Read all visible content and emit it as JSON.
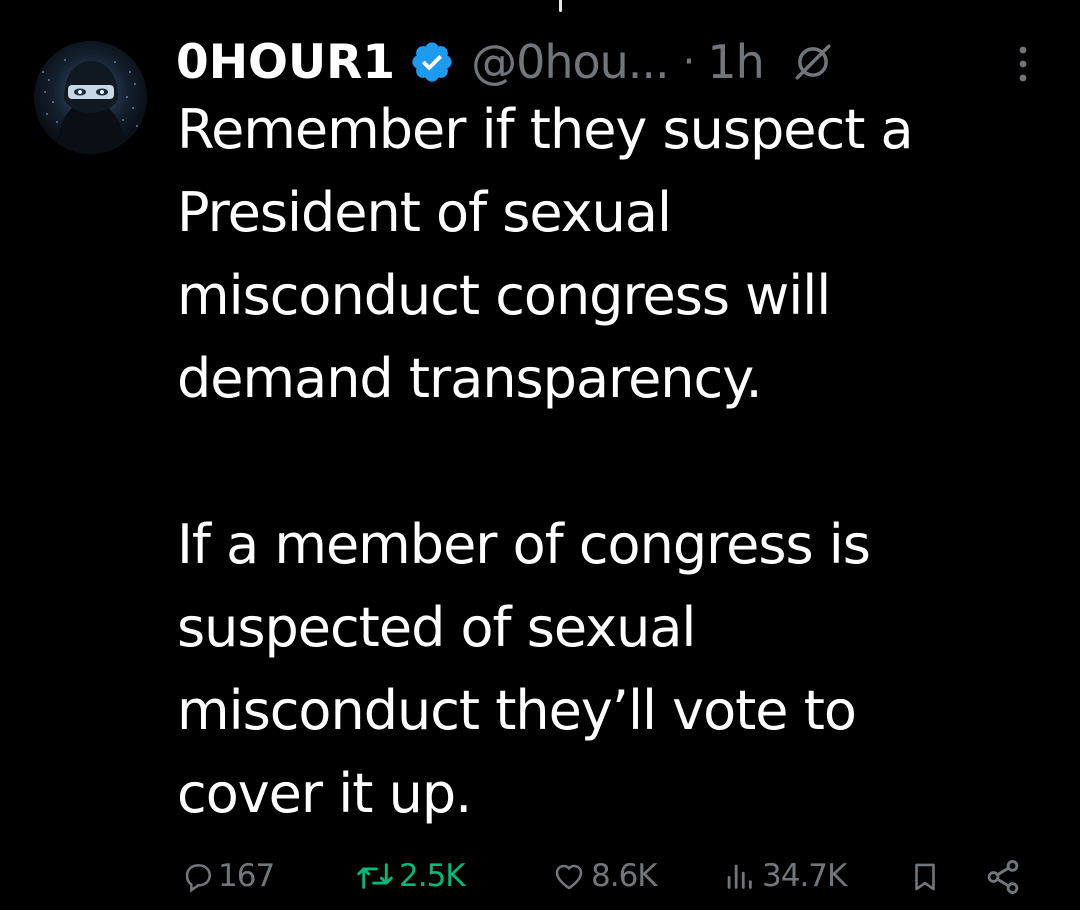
{
  "post": {
    "display_name": "0HOUR1",
    "verified": true,
    "handle": "@0hou...",
    "separator": "·",
    "time": "1h",
    "paragraphs": [
      "Remember if they suspect a President of sexual misconduct congress will demand transparency.",
      "If a member of congress is suspected of sexual misconduct they’ll vote to cover it up."
    ],
    "lines": [
      "Remember if they suspect a",
      "President of sexual",
      "misconduct congress will",
      "demand transparency.",
      "If a member of congress is",
      "suspected of sexual",
      "misconduct they’ll vote to",
      "cover it up."
    ]
  },
  "actions": {
    "replies": "167",
    "reposts": "2.5K",
    "likes": "8.6K",
    "views": "34.7K"
  },
  "icons": {
    "verified": "verified-badge-icon",
    "grok": "grok-icon",
    "more": "more-vertical-icon",
    "reply": "reply-icon",
    "repost": "repost-icon",
    "like": "heart-icon",
    "views": "views-icon",
    "bookmark": "bookmark-icon",
    "share": "share-icon"
  },
  "colors": {
    "background": "#000000",
    "text": "#ffffff",
    "muted": "#71767b",
    "verified": "#1d9bf0",
    "repost_active": "#00ba7c"
  }
}
